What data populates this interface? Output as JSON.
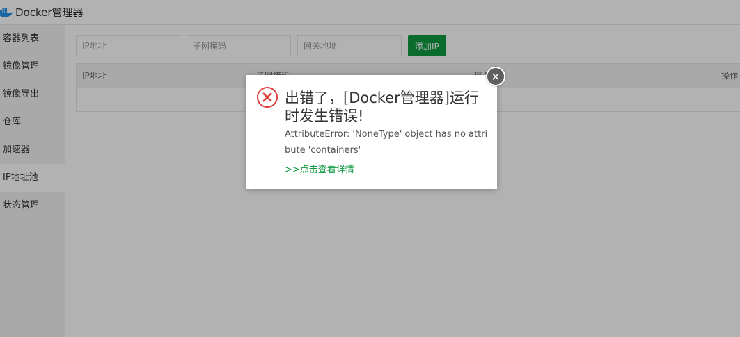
{
  "app": {
    "title": "Docker管理器"
  },
  "sidebar": {
    "items": [
      {
        "label": "容器列表"
      },
      {
        "label": "镜像管理"
      },
      {
        "label": "镜像导出"
      },
      {
        "label": "仓库"
      },
      {
        "label": "加速器"
      },
      {
        "label": "IP地址池"
      },
      {
        "label": "状态管理"
      }
    ],
    "active_index": 5
  },
  "form": {
    "ip_placeholder": "IP地址",
    "mask_placeholder": "子网掩码",
    "gateway_placeholder": "网关地址",
    "add_button": "添加IP"
  },
  "table": {
    "columns": [
      "IP地址",
      "子网掩码",
      "网关",
      "操作"
    ]
  },
  "dialog": {
    "title": "出错了，[Docker管理器]运行时发生错误!",
    "message": "AttributeError: 'NoneType' object has no attribute 'containers'",
    "detail_link": ">>点击查看详情",
    "close_symbol": "✕"
  },
  "colors": {
    "accent": "#0e9a40",
    "error": "#e03c3c"
  },
  "icons": {
    "logo": "docker-whale-icon",
    "error": "error-circle-x-icon",
    "close": "close-icon"
  }
}
